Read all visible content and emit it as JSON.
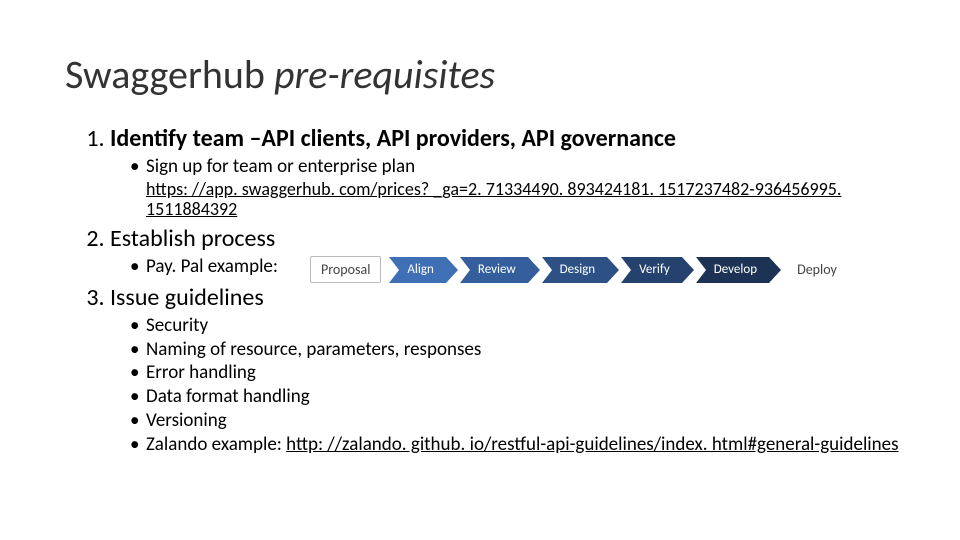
{
  "title": {
    "plain": "Swaggerhub ",
    "italic": "pre-requisites"
  },
  "items": [
    {
      "heading": "Identify team –API clients, API providers, API governance",
      "bold": true,
      "sub": [
        {
          "text": "Sign up for team or enterprise plan"
        }
      ],
      "link": {
        "href": "https://app.swaggerhub.com/prices?_ga=2.71334490.893424181.1517237482-936456995.1511884392",
        "text": "https: //app. swaggerhub. com/prices? _ga=2. 71334490. 893424181. 1517237482-936456995. 1511884392"
      }
    },
    {
      "heading": "Establish process",
      "bold": false,
      "sub": [
        {
          "text": "Pay. Pal example:"
        }
      ]
    },
    {
      "heading": "Issue guidelines",
      "bold": false,
      "sub": [
        {
          "text": "Security"
        },
        {
          "text": "Naming of resource, parameters, responses"
        },
        {
          "text": "Error handling"
        },
        {
          "text": "Data format handling"
        },
        {
          "text": "Versioning"
        },
        {
          "text": "Zalando example:  ",
          "link": {
            "href": "http://zalando.github.io/restful-api-guidelines/index.html#general-guidelines",
            "text": "http: //zalando. github. io/restful-api-guidelines/index. html#general-guidelines"
          }
        }
      ]
    }
  ],
  "process": {
    "start": "Proposal",
    "steps": [
      "Align",
      "Review",
      "Design",
      "Verify",
      "Develop"
    ],
    "end": "Deploy"
  }
}
